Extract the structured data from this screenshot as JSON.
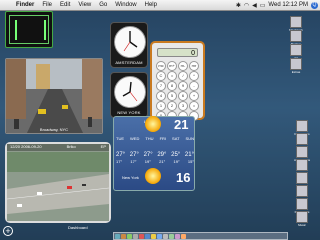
{
  "menubar": {
    "apple_symbol": "",
    "items": [
      "Finder",
      "File",
      "Edit",
      "View",
      "Go",
      "Window",
      "Help"
    ],
    "clock": "Wed 12:12 PM",
    "spotlight_symbol": "Q"
  },
  "webcam": {
    "label": "Broadway, NYC"
  },
  "clocks": [
    {
      "city": "AMSTERDAM"
    },
    {
      "city": "NEW YORK"
    }
  ],
  "calculator": {
    "display": "0",
    "buttons": [
      "mc",
      "m+",
      "m-",
      "mr",
      "C",
      "=",
      "/",
      "*",
      "7",
      "8",
      "9",
      "-",
      "4",
      "5",
      "6",
      "+",
      "1",
      "2",
      "3",
      "=",
      "0",
      ".",
      "",
      ""
    ]
  },
  "weather": [
    {
      "city": "Lisbon",
      "temp": "21",
      "days": [
        "TUE",
        "WED",
        "THU",
        "FRI",
        "SAT",
        "SUN",
        "MON"
      ],
      "highs": [
        "27°",
        "27°",
        "27°",
        "29°",
        "25°",
        "21°",
        "21°"
      ],
      "lows": [
        "17°",
        "17°",
        "19°",
        "21°",
        "19°",
        "15°",
        "15°"
      ]
    },
    {
      "city": "New York",
      "temp": "16"
    }
  ],
  "traffic_cam": {
    "timestamp": "12/20  2006-09-20",
    "brand": "Brlko",
    "channel": "EP"
  },
  "dashboard_label": "Dashboard",
  "add_symbol": "+",
  "desktop_icons": [
    "Macintosh HD",
    "Backup",
    "Art",
    "Extras",
    "Documents",
    "Macro",
    "Applications",
    "Hosting",
    "Desktop",
    "Notes",
    "Downloads",
    "Music"
  ],
  "colors": {
    "calc_border": "#c97a20",
    "weather_bg": "#2b4a85"
  }
}
